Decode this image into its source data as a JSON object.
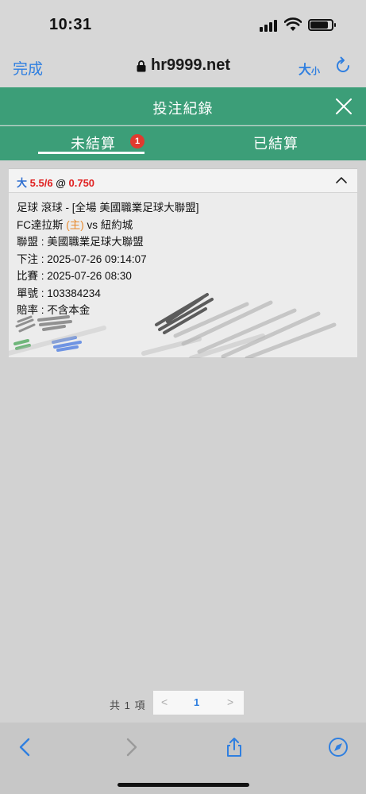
{
  "status_bar": {
    "time": "10:31"
  },
  "browser": {
    "done_label": "完成",
    "url": "hr9999.net",
    "text_size_large": "大",
    "text_size_small": "小"
  },
  "header": {
    "title": "投注紀錄",
    "tabs": [
      {
        "label": "未結算",
        "badge": "1",
        "active": true
      },
      {
        "label": "已結算",
        "active": false
      }
    ]
  },
  "bet": {
    "pick_side": "大",
    "pick_line": "5.5/6",
    "pick_at": "@",
    "pick_odds": "0.750",
    "market": "足球 滾球 - [全場 美國職業足球大聯盟]",
    "home_team": "FC達拉斯",
    "home_tag": "(主)",
    "vs": "vs",
    "away_team": "紐約城",
    "league": "聯盟 : 美國職業足球大聯盟",
    "placed": "下注 : 2025-07-26 09:14:07",
    "match_time": "比賽 : 2025-07-26 08:30",
    "ticket": "單號 : 103384234",
    "odds_type": "賠率 : 不含本金"
  },
  "pager": {
    "total": "共 1 項",
    "prev": "<",
    "page": "1",
    "next": ">"
  },
  "colors": {
    "accent_teal": "#3c9e78",
    "ios_blue": "#2f7fe0",
    "badge_red": "#e03a2f",
    "odds_red": "#e02020",
    "home_orange": "#e8892b"
  }
}
